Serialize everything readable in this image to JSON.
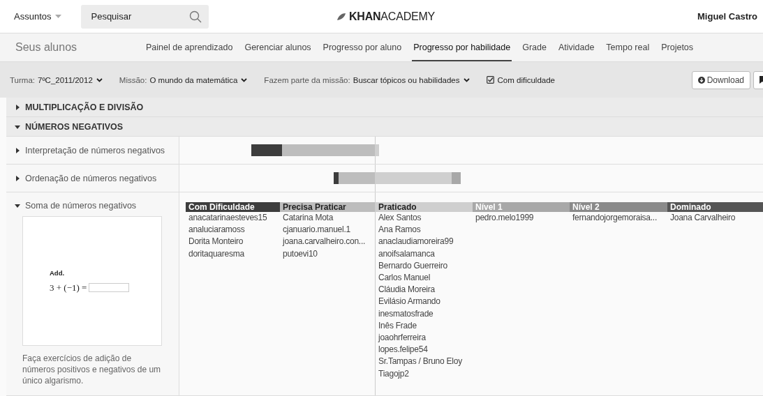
{
  "header": {
    "subjects_menu": "Assuntos",
    "search": {
      "placeholder": "Pesquisar"
    },
    "logo": "**KHAN**ACADEMY",
    "user": "Miguel Castro"
  },
  "nav": {
    "title": "Seus alunos",
    "tabs": [
      {
        "label": "Painel de aprendizado",
        "selected": false
      },
      {
        "label": "Gerenciar alunos",
        "selected": false
      },
      {
        "label": "Progresso por aluno",
        "selected": false
      },
      {
        "label": "Progresso por habilidade",
        "selected": true
      },
      {
        "label": "Grade",
        "selected": false
      },
      {
        "label": "Atividade",
        "selected": false
      },
      {
        "label": "Tempo real",
        "selected": false
      },
      {
        "label": "Projetos",
        "selected": false
      }
    ]
  },
  "filters": [
    {
      "kind": "dropdown",
      "label": "Turma:",
      "value": "7ºC_2011/2012"
    },
    {
      "kind": "dropdown",
      "label": "Missão:",
      "value": "O mundo da matemática"
    },
    {
      "kind": "dropdown",
      "label": "Fazem parte da missão:",
      "value": "Buscar tópicos ou habilidades"
    },
    {
      "kind": "checkbox",
      "label": "Com dificuldade",
      "checked": true
    }
  ],
  "actions": [
    {
      "kind": "download",
      "label": "Download"
    },
    {
      "kind": "bookmark"
    }
  ],
  "sections": [
    {
      "title": "MULTIPLICAÇÃO E DIVISÃO",
      "expanded": false
    },
    {
      "title": "NÚMEROS NEGATIVOS",
      "expanded": true,
      "skills": [
        {
          "title": "Interpretação de números negativos",
          "expanded": false,
          "bar": [
            {
              "kind": "struggling"
            },
            {
              "kind": "needs_practice"
            },
            {
              "kind": "practiced"
            }
          ]
        },
        {
          "title": "Ordenação de números negativos",
          "expanded": false,
          "bar": [
            {
              "kind": "struggling"
            },
            {
              "kind": "needs_practice"
            },
            {
              "kind": "practiced"
            },
            {
              "kind": "level_1"
            }
          ]
        },
        {
          "title": "Soma de números negativos",
          "expanded": true,
          "preview": {
            "instruction": "Add.",
            "expression": "3 + (−1) ="
          },
          "description": "Faça exercícios de adição de números positivos e negativos de um único algarismo.",
          "columns": [
            {
              "kind": "struggling",
              "title": "Com Dificuldade",
              "students": [
                "anacatarinaesteves15",
                "analuciaramoss",
                "Dorita Monteiro",
                "doritaquaresma"
              ]
            },
            {
              "kind": "needs_practice",
              "title": "Precisa Praticar",
              "students": [
                "Catarina Mota",
                "cjanuario.manuel.1",
                "joana.carvalheiro.con...",
                "putoevi10"
              ]
            },
            {
              "kind": "practiced",
              "title": "Praticado",
              "students": [
                "Alex Santos",
                "Ana Ramos",
                "anaclaudiamoreira99",
                "anoifsalamanca",
                "Bernardo Guerreiro",
                "Carlos Manuel",
                "Cláudia Moreira",
                "Evilásio Armando",
                "inesmatosfrade",
                "Inês Frade",
                "joaohrferreira",
                "lopes.felipe54",
                "Sr.Tampas / Bruno Eloy",
                "Tiagojp2"
              ]
            },
            {
              "kind": "level_1",
              "title": "Nível 1",
              "students": [
                "pedro.melo1999"
              ]
            },
            {
              "kind": "level_2",
              "title": "Nível 2",
              "students": [
                "fernandojorgemoraisa..."
              ]
            },
            {
              "kind": "mastered",
              "title": "Dominado",
              "students": [
                "Joana Carvalheiro"
              ]
            }
          ]
        }
      ]
    }
  ]
}
